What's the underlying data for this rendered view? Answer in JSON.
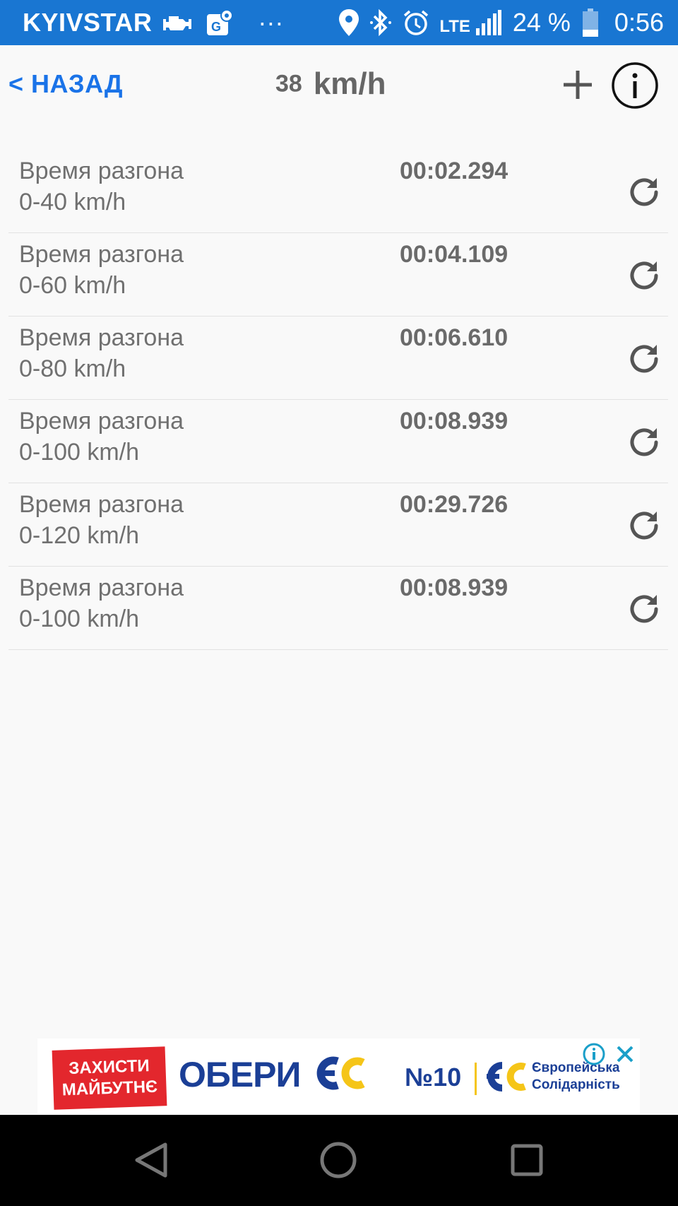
{
  "status_bar": {
    "carrier": "KYIVSTAR",
    "dots": "···",
    "network": "LTE",
    "battery_percent": "24 %",
    "time": "0:56",
    "icons": [
      "check-engine-icon",
      "maps-icon",
      "location-icon",
      "bluetooth-icon",
      "alarm-icon",
      "signal-icon",
      "battery-icon"
    ]
  },
  "header": {
    "back_label": "< НАЗАД",
    "speed_value": "38",
    "speed_unit": "km/h"
  },
  "results": [
    {
      "label": "Время разгона",
      "range": "0-40 km/h",
      "time": "00:02.294"
    },
    {
      "label": "Время разгона",
      "range": "0-60 km/h",
      "time": "00:04.109"
    },
    {
      "label": "Время разгона",
      "range": "0-80 km/h",
      "time": "00:06.610"
    },
    {
      "label": "Время разгона",
      "range": "0-100 km/h",
      "time": "00:08.939"
    },
    {
      "label": "Время разгона",
      "range": "0-120 km/h",
      "time": "00:29.726"
    },
    {
      "label": "Время разгона",
      "range": "0-100 km/h",
      "time": "00:08.939"
    }
  ],
  "ad": {
    "red_line1": "ЗАХИСТИ",
    "red_line2": "МАЙБУТНЄ",
    "main_text": "ОБЕРИ",
    "number": "№10",
    "brand_line1": "Європейська",
    "brand_line2": "Солідарність"
  },
  "colors": {
    "status_bar": "#1976d2",
    "accent": "#1a73e8",
    "ad_blue": "#1b3f96",
    "ad_red": "#e3272d",
    "ad_yellow": "#f5c518"
  }
}
